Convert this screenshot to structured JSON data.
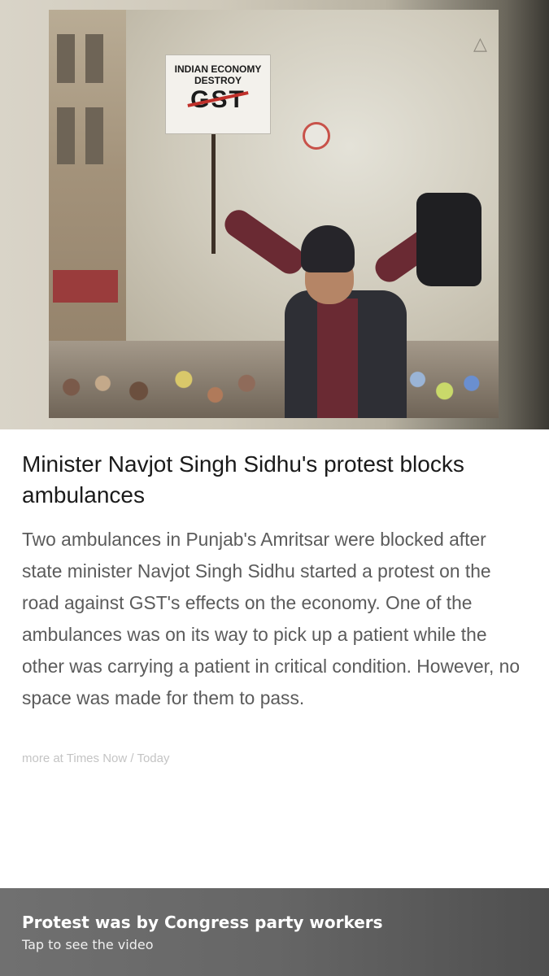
{
  "hero": {
    "sign_line1": "INDIAN ECONOMY",
    "sign_line2": "DESTROY",
    "sign_line3": "GST"
  },
  "article": {
    "headline": "Minister Navjot Singh Sidhu's protest blocks ambulances",
    "body": "Two ambulances in Punjab's Amritsar were blocked after state minister Navjot Singh Sidhu started a protest on the road against GST's effects on the economy. One of the ambulances was on its way to pick up a patient while the other was carrying a patient in critical condition. However, no space was made for them to pass.",
    "source_prefix": "more at ",
    "source_name": "Times Now",
    "source_sep": " / ",
    "source_time": "Today"
  },
  "bottom_bar": {
    "title": "Protest was by Congress party workers",
    "subtitle": "Tap to see the video"
  }
}
